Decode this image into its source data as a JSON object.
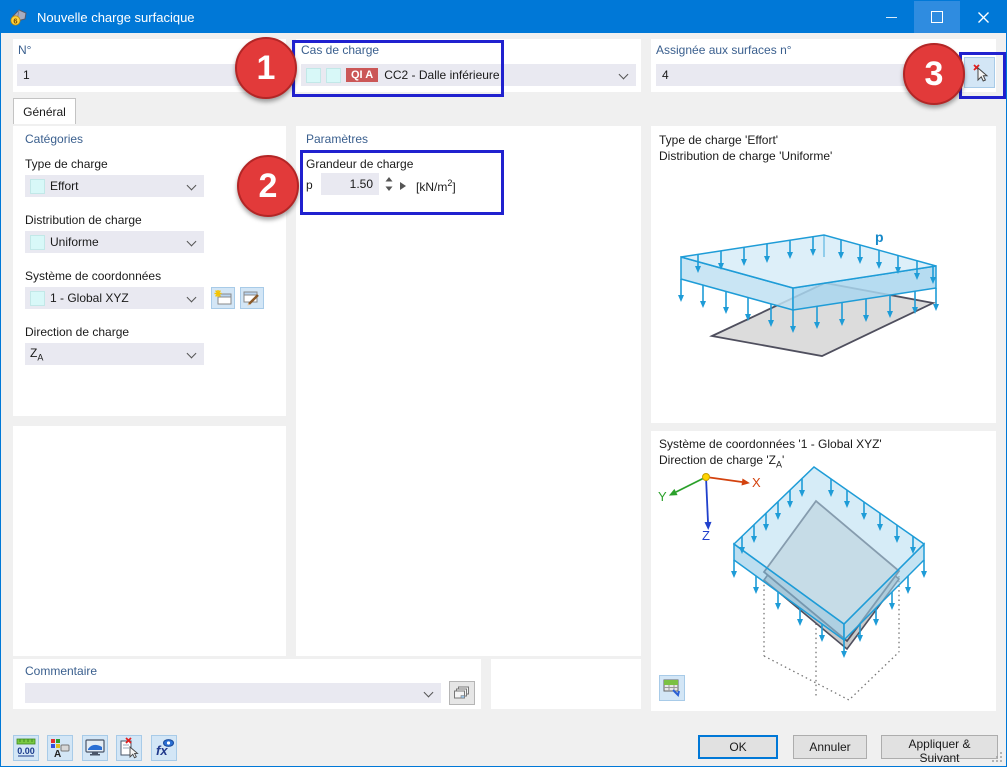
{
  "colors": {
    "accent": "#0078d7",
    "annotation_red": "#e23a3a",
    "annotation_blue": "#2021cf",
    "badge_red": "#cb5757",
    "field_bg": "#e9e9f1",
    "header_text": "#3a5f8e",
    "diagram_blue": "#1e9cd7"
  },
  "titlebar": {
    "title": "Nouvelle charge surfacique",
    "icon_badge": "6"
  },
  "top_row": {
    "number": {
      "label": "N°",
      "value": "1"
    },
    "load_case": {
      "label": "Cas de charge",
      "badge": "QI A",
      "value": "CC2 - Dalle inférieure"
    },
    "surfaces": {
      "label": "Assignée aux surfaces n°",
      "value": "4"
    }
  },
  "annotations": {
    "circle1": "1",
    "circle2": "2",
    "circle3": "3"
  },
  "tabs": {
    "general": "Général"
  },
  "categories": {
    "header": "Catégories",
    "type": {
      "label": "Type de charge",
      "value": "Effort"
    },
    "distribution": {
      "label": "Distribution de charge",
      "value": "Uniforme"
    },
    "coord_system": {
      "label": "Système de coordonnées",
      "value": "1 - Global XYZ"
    },
    "direction": {
      "label": "Direction de charge",
      "value_main": "Z",
      "value_sub": "A"
    }
  },
  "parameters": {
    "header": "Paramètres",
    "group": "Grandeur de charge",
    "symbol": "p",
    "value": "1.50",
    "unit_prefix": "[kN/m",
    "unit_sup": "2",
    "unit_suffix": "]"
  },
  "preview_top": {
    "line1": "Type de charge 'Effort'",
    "line2": "Distribution de charge 'Uniforme'",
    "load_label": "p"
  },
  "preview_bottom": {
    "line1": "Système de coordonnées '1 - Global XYZ'",
    "line2_prefix": "Direction de charge 'Z",
    "line2_sub": "A",
    "line2_suffix": "'",
    "axis_x": "X",
    "axis_y": "Y",
    "axis_z": "Z"
  },
  "comment": {
    "header": "Commentaire",
    "value": ""
  },
  "toolbar": {
    "units_text": "0.00",
    "formula_text": "fx"
  },
  "buttons": {
    "ok": "OK",
    "cancel": "Annuler",
    "apply_next": "Appliquer & Suivant"
  }
}
